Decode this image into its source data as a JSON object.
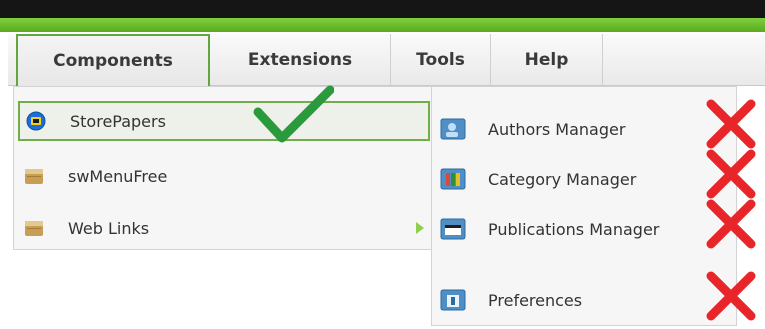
{
  "menubar": {
    "tabs": [
      {
        "label": "Components",
        "active": true
      },
      {
        "label": "Extensions",
        "active": false
      },
      {
        "label": "Tools",
        "active": false
      },
      {
        "label": "Help",
        "active": false
      }
    ]
  },
  "components_menu": {
    "items": [
      {
        "label": "StorePapers",
        "icon": "storepapers-icon",
        "highlighted": true
      },
      {
        "label": "swMenuFree",
        "icon": "component-box-icon"
      },
      {
        "label": "Web Links",
        "icon": "component-box-icon",
        "has_submenu": true
      }
    ]
  },
  "storepapers_submenu": {
    "items": [
      {
        "label": "Authors Manager",
        "icon": "users-icon"
      },
      {
        "label": "Category Manager",
        "icon": "category-icon"
      },
      {
        "label": "Publications Manager",
        "icon": "publications-icon"
      },
      {
        "label": "Preferences",
        "icon": "preferences-icon"
      }
    ]
  },
  "annotations": {
    "check_color": "#2a9a3c",
    "cross_color": "#e8262a"
  },
  "colors": {
    "topbar": "#151515",
    "green_bar": "#6ab82b",
    "active_tab_border": "#62a640"
  }
}
